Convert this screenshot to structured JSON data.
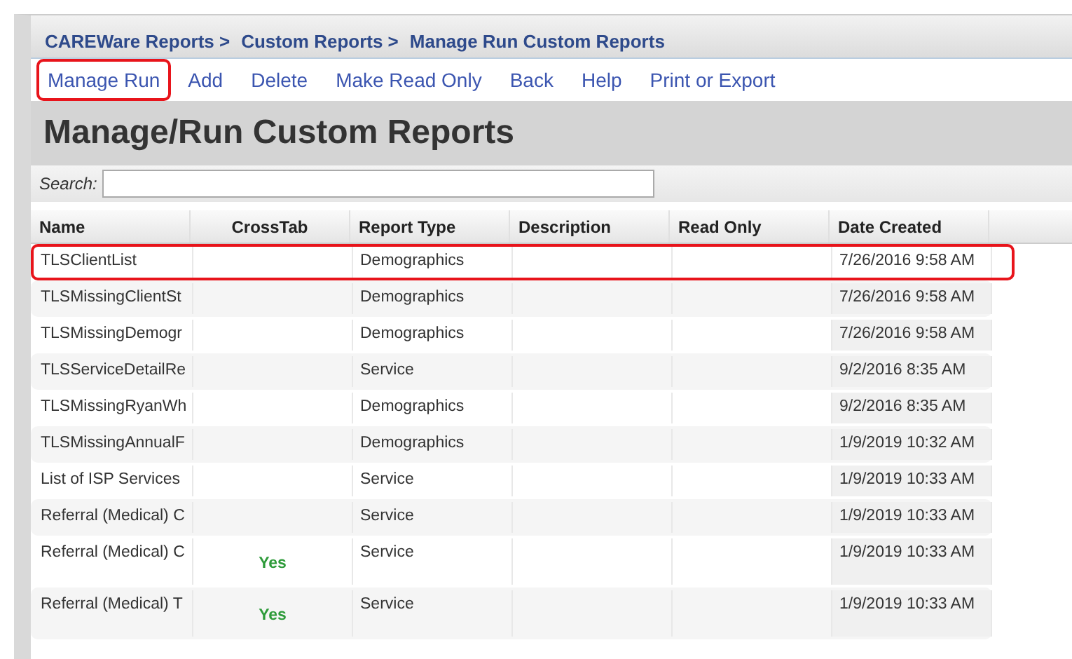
{
  "breadcrumbs": [
    "CAREWare Reports >",
    "Custom Reports >",
    "Manage Run Custom Reports"
  ],
  "toolbar": [
    {
      "label": "Manage Run",
      "highlighted": true
    },
    {
      "label": "Add",
      "highlighted": false
    },
    {
      "label": "Delete",
      "highlighted": false
    },
    {
      "label": "Make Read Only",
      "highlighted": false
    },
    {
      "label": "Back",
      "highlighted": false
    },
    {
      "label": "Help",
      "highlighted": false
    },
    {
      "label": "Print or Export",
      "highlighted": false
    }
  ],
  "title": "Manage/Run Custom Reports",
  "search": {
    "label": "Search:"
  },
  "table": {
    "columns": [
      "Name",
      "CrossTab",
      "Report Type",
      "Description",
      "Read Only",
      "Date Created"
    ],
    "rows": [
      {
        "name": "TLSClientList",
        "crosstab": "",
        "report_type": "Demographics",
        "date_created": "7/26/2016 9:58 AM",
        "highlighted": true
      },
      {
        "name": "TLSMissingClientSt",
        "crosstab": "",
        "report_type": "Demographics",
        "date_created": "7/26/2016 9:58 AM",
        "highlighted": false
      },
      {
        "name": "TLSMissingDemogr",
        "crosstab": "",
        "report_type": "Demographics",
        "date_created": "7/26/2016 9:58 AM",
        "highlighted": false
      },
      {
        "name": "TLSServiceDetailRe",
        "crosstab": "",
        "report_type": "Service",
        "date_created": "9/2/2016 8:35 AM",
        "highlighted": false
      },
      {
        "name": "TLSMissingRyanWh",
        "crosstab": "",
        "report_type": "Demographics",
        "date_created": "9/2/2016 8:35 AM",
        "highlighted": false
      },
      {
        "name": "TLSMissingAnnualF",
        "crosstab": "",
        "report_type": "Demographics",
        "date_created": "1/9/2019 10:32 AM",
        "highlighted": false
      },
      {
        "name": "List of ISP Services",
        "crosstab": "",
        "report_type": "Service",
        "date_created": "1/9/2019 10:33 AM",
        "highlighted": false
      },
      {
        "name": "Referral (Medical) C",
        "crosstab": "",
        "report_type": "Service",
        "date_created": "1/9/2019 10:33 AM",
        "highlighted": false
      },
      {
        "name": "Referral (Medical) C",
        "crosstab": "Yes",
        "report_type": "Service",
        "date_created": "1/9/2019 10:33 AM",
        "highlighted": false
      },
      {
        "name": "Referral (Medical) T",
        "crosstab": "Yes",
        "report_type": "Service",
        "date_created": "1/9/2019 10:33 AM",
        "highlighted": false
      }
    ]
  }
}
